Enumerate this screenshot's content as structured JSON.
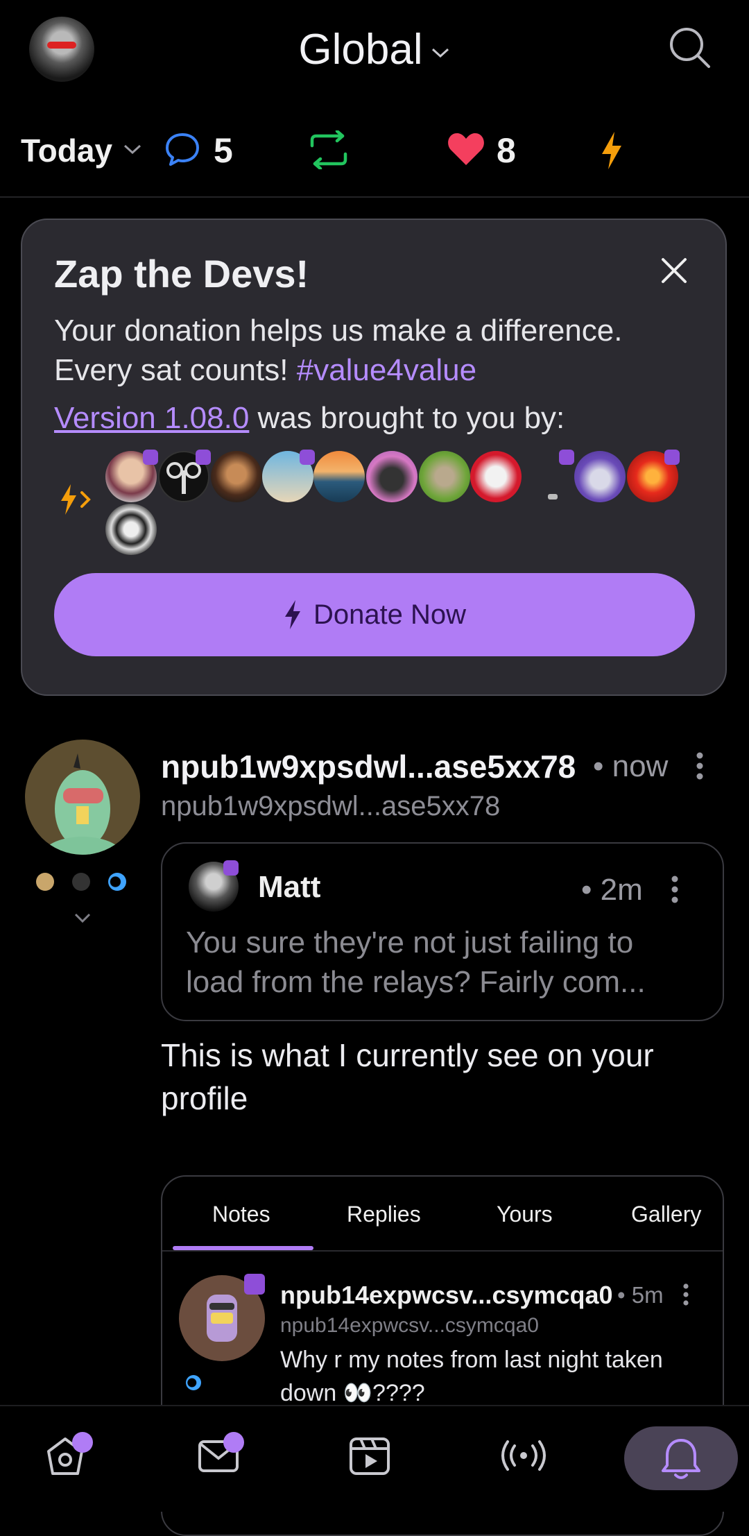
{
  "header": {
    "feed_title": "Global",
    "icons": {
      "avatar": "user-avatar",
      "search": "search-icon"
    }
  },
  "stats": {
    "period": "Today",
    "replies": "5",
    "likes": "8",
    "colors": {
      "reply": "#3b82f6",
      "repost": "#22c55e",
      "like": "#f43f5e",
      "zap": "#f59e0b"
    }
  },
  "donate_card": {
    "title": "Zap the Devs!",
    "text_line1": "Your donation helps us make a difference.",
    "text_line2": "Every sat counts!",
    "hashtag": "#value4value",
    "version_link": "Version 1.08.0",
    "version_suffix": " was brought to you by:",
    "button_label": "Donate Now",
    "accent": "#b07cf5"
  },
  "post": {
    "author": "npub1w9xpsdwl...ase5xx78",
    "handle": "npub1w9xpsdwl...ase5xx78",
    "time": "• now",
    "quote": {
      "author": "Matt",
      "time": "• 2m",
      "text": "You sure they're not just failing to load from the relays? Fairly com..."
    },
    "body": "This is what I currently see on your profile",
    "embed": {
      "tabs": [
        "Notes",
        "Replies",
        "Yours",
        "Gallery"
      ],
      "active_tab": "Notes",
      "note": {
        "author": "npub14expwcsv...csymcqa0",
        "handle": "npub14expwcsv...csymcqa0",
        "time": "• 5m",
        "text": "Why r my notes from last night taken down 👀????"
      }
    }
  },
  "bottom_nav": {
    "items": [
      "home-icon",
      "messages-icon",
      "video-icon",
      "broadcast-icon",
      "notifications-icon"
    ],
    "active": "notifications-icon"
  }
}
